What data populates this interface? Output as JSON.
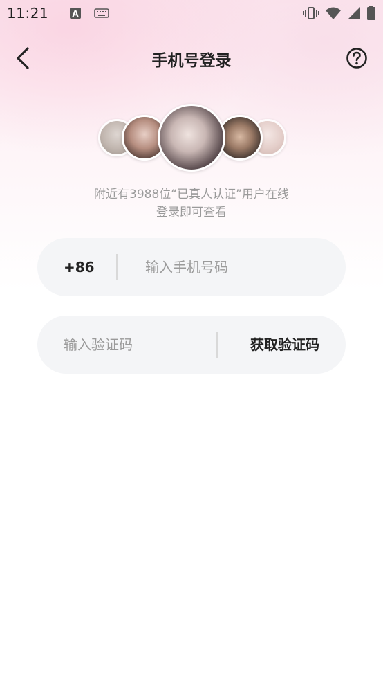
{
  "status_bar": {
    "time": "11:21"
  },
  "header": {
    "title": "手机号登录"
  },
  "icons": {
    "back": "back-arrow-icon",
    "help": "question-circle-icon"
  },
  "subtitle": {
    "line1": "附近有3988位“已真人认证”用户在线",
    "line2": "登录即可查看"
  },
  "phone_form": {
    "country_code": "+86",
    "phone_placeholder": "输入手机号码",
    "code_placeholder": "输入验证码",
    "get_code_label": "获取验证码"
  },
  "colors": {
    "accent_text": "#222222",
    "hint_text": "#9a9a9a",
    "field_bg": "#f4f5f7",
    "bg_pink": "#fbe6ee"
  }
}
